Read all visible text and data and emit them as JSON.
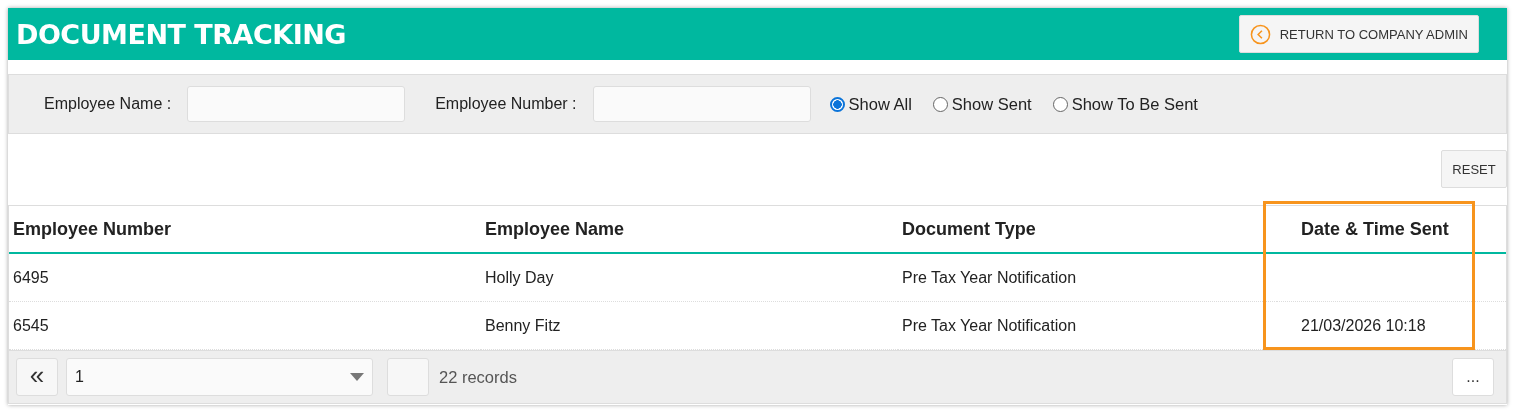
{
  "header": {
    "title": "DOCUMENT TRACKING",
    "return_button": {
      "label": "RETURN TO COMPANY ADMIN"
    }
  },
  "filters": {
    "fields": [
      {
        "label": "Employee Name :"
      },
      {
        "label": "Employee Number :"
      }
    ],
    "options": [
      {
        "label": "Show All",
        "selected": true
      },
      {
        "label": "Show Sent",
        "selected": false
      },
      {
        "label": "Show To Be Sent",
        "selected": false
      }
    ]
  },
  "reset_button": "RESET",
  "table": {
    "columns": [
      {
        "label": "Employee Number",
        "highlighted": false
      },
      {
        "label": "Employee Name",
        "highlighted": false
      },
      {
        "label": "Document Type",
        "highlighted": false
      },
      {
        "label": "Date & Time Sent",
        "highlighted": true
      }
    ],
    "rows": [
      {
        "employee_number": "6495",
        "employee_name": "Holly Day",
        "document_type": "Pre Tax Year Notification"
      },
      {
        "employee_number": "6545",
        "employee_name": "Benny Fitz",
        "document_type": "Pre Tax Year Notification",
        "date_time_sent": "21/03/2026 10:18"
      }
    ]
  },
  "pager": {
    "first_button": "«",
    "page": "1",
    "record_count": "22 records",
    "more_button": "..."
  }
}
